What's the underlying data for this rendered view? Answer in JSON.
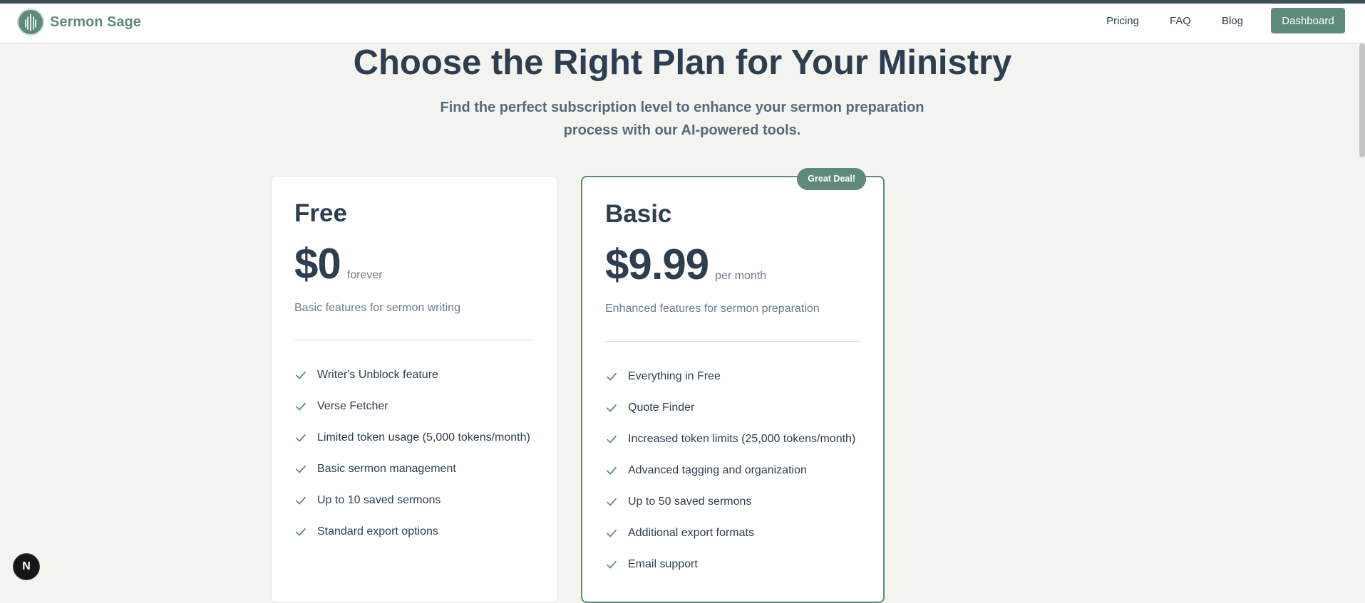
{
  "header": {
    "brand": "Sermon Sage",
    "nav": [
      "Pricing",
      "FAQ",
      "Blog"
    ],
    "dashboard_label": "Dashboard"
  },
  "hero": {
    "title": "Choose the Right Plan for Your Ministry",
    "subtitle": "Find the perfect subscription level to enhance your sermon preparation process with our AI-powered tools."
  },
  "plans": [
    {
      "name": "Free",
      "price": "$0",
      "period": "forever",
      "description": "Basic features for sermon writing",
      "features": [
        "Writer's Unblock feature",
        "Verse Fetcher",
        "Limited token usage (5,000 tokens/month)",
        "Basic sermon management",
        "Up to 10 saved sermons",
        "Standard export options"
      ]
    },
    {
      "name": "Basic",
      "badge": "Great Deal!",
      "price": "$9.99",
      "period": "per month",
      "description": "Enhanced features for sermon preparation",
      "features": [
        "Everything in Free",
        "Quote Finder",
        "Increased token limits (25,000 tokens/month)",
        "Advanced tagging and organization",
        "Up to 50 saved sermons",
        "Additional export formats",
        "Email support"
      ]
    }
  ],
  "dev_indicator": "N",
  "colors": {
    "accent": "#5e8a7c",
    "heading": "#2d3e50",
    "muted": "#6b7b8b",
    "background": "#f3f3ef"
  },
  "icons": {
    "logo": "wheat-logo-icon",
    "feature": "check-icon"
  }
}
